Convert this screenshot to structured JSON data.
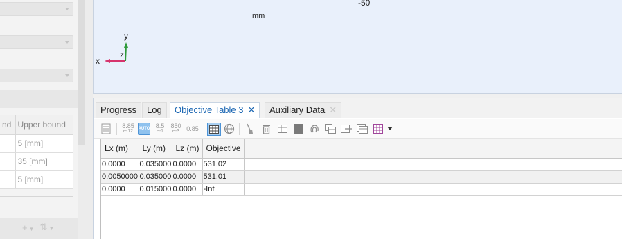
{
  "settings_panel": {
    "bounds_table": {
      "columns": [
        "nd",
        "Upper bound"
      ],
      "rows": [
        [
          "",
          "5 [mm]"
        ],
        [
          "",
          "35 [mm]"
        ],
        [
          "",
          "5 [mm]"
        ]
      ]
    },
    "tools": {
      "add_symbol": "+",
      "move_symbol": "⇅"
    }
  },
  "graphics": {
    "axis_tick_label": "-50",
    "unit_label": "mm",
    "triad": {
      "x": "x",
      "y": "y",
      "z": "z"
    }
  },
  "tabs": [
    {
      "label": "Progress",
      "active": false,
      "closable": false
    },
    {
      "label": "Log",
      "active": false,
      "closable": false
    },
    {
      "label": "Objective Table 3",
      "active": true,
      "closable": true,
      "close": "✕"
    },
    {
      "label": "Auxiliary Data",
      "active": false,
      "closable": true,
      "close": "✕"
    }
  ],
  "toolbar": {
    "precision_buttons": [
      {
        "top": "8.85",
        "bottom": "e-12"
      },
      {
        "top": "AUTO",
        "bottom": ""
      },
      {
        "top": "8.5",
        "bottom": "e-1"
      },
      {
        "top": "850",
        "bottom": "e-3"
      },
      {
        "top": "0.85",
        "bottom": ""
      }
    ],
    "icons": [
      "table-format-icon",
      "table-grid-icon",
      "globe-icon",
      "clear-brush-icon",
      "delete-icon",
      "table-columns-icon",
      "stop-square-icon",
      "fingerprint-icon",
      "copy-table-icon",
      "export-icon",
      "table-copy-icon",
      "table-plot-icon",
      "dropdown-caret-icon"
    ]
  },
  "results_table": {
    "columns": [
      "Lx (m)",
      "Ly (m)",
      "Lz (m)",
      "Objective"
    ],
    "rows": [
      [
        "0.0000",
        "0.035000",
        "0.0000",
        "531.02"
      ],
      [
        "0.0050000",
        "0.035000",
        "0.0000",
        "531.01"
      ],
      [
        "0.0000",
        "0.015000",
        "0.0000",
        "-Inf"
      ]
    ]
  }
}
